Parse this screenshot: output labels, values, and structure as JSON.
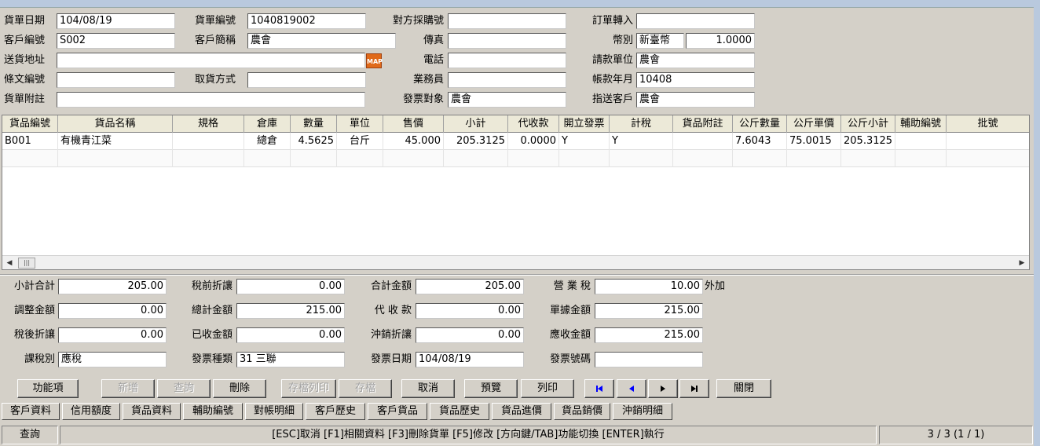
{
  "header": {
    "order_date_label": "貨單日期",
    "order_date": "104/08/19",
    "order_no_label": "貨單編號",
    "order_no": "1040819002",
    "po_no_label": "對方採購號",
    "po_no": "",
    "order_import_label": "訂單轉入",
    "order_import": "",
    "customer_id_label": "客戶編號",
    "customer_id": "S002",
    "customer_short_label": "客戶簡稱",
    "customer_short": "農會",
    "fax_label": "傳真",
    "fax": "",
    "currency_label": "幣別",
    "currency": "新臺幣",
    "exchange_rate": "1.0000",
    "ship_addr_label": "送貨地址",
    "ship_addr": "",
    "map_label": "MAP",
    "phone_label": "電話",
    "phone": "",
    "billing_unit_label": "請款單位",
    "billing_unit": "農會",
    "terms_no_label": "條文編號",
    "terms_no": "",
    "pickup_label": "取貨方式",
    "pickup": "",
    "sales_label": "業務員",
    "sales": "",
    "account_month_label": "帳款年月",
    "account_month": "10408",
    "note_label": "貨單附註",
    "note": "",
    "invoice_target_label": "發票對象",
    "invoice_target": "農會",
    "deliver_to_label": "指送客戶",
    "deliver_to": "農會"
  },
  "grid": {
    "columns": [
      "貨品編號",
      "貨品名稱",
      "規格",
      "倉庫",
      "數量",
      "單位",
      "售價",
      "小計",
      "代收款",
      "開立發票",
      "計稅",
      "貨品附註",
      "公斤數量",
      "公斤單價",
      "公斤小計",
      "輔助編號",
      "批號"
    ],
    "rows": [
      {
        "item_no": "B001",
        "item_name": "有機青江菜",
        "spec": "",
        "warehouse": "總倉",
        "qty": "4.5625",
        "unit": "台斤",
        "price": "45.000",
        "subtotal": "205.3125",
        "collect": "0.0000",
        "invoice": "Y",
        "tax": "Y",
        "item_note": "",
        "kg_qty": "7.6043",
        "kg_price": "75.0015",
        "kg_subtotal": "205.3125",
        "aux_no": "",
        "batch_no": ""
      }
    ]
  },
  "totals": {
    "subtotal_label": "小計合計",
    "subtotal": "205.00",
    "pretax_discount_label": "稅前折讓",
    "pretax_discount": "0.00",
    "total_amount_label": "合計金額",
    "total_amount": "205.00",
    "business_tax_label": "營 業 稅",
    "business_tax": "10.00",
    "tax_mode": "外加",
    "adjust_label": "調整金額",
    "adjust": "0.00",
    "grand_total_label": "總計金額",
    "grand_total": "215.00",
    "collect_label": "代 收 款",
    "collect": "0.00",
    "doc_amount_label": "單據金額",
    "doc_amount": "215.00",
    "posttax_discount_label": "稅後折讓",
    "posttax_discount": "0.00",
    "received_label": "已收金額",
    "received": "0.00",
    "offset_discount_label": "沖銷折讓",
    "offset_discount": "0.00",
    "receivable_label": "應收金額",
    "receivable": "215.00",
    "tax_type_label": "課稅別",
    "tax_type": "應稅",
    "invoice_kind_label": "發票種類",
    "invoice_kind": "31 三聯",
    "invoice_date_label": "發票日期",
    "invoice_date": "104/08/19",
    "invoice_no_label": "發票號碼",
    "invoice_no": ""
  },
  "toolbar": {
    "func": "功能項",
    "add": "新增",
    "query": "查詢",
    "delete": "刪除",
    "save_print": "存檔列印",
    "save": "存檔",
    "cancel": "取消",
    "preview": "預覽",
    "print": "列印",
    "close": "關閉"
  },
  "tabs": [
    "客戶資料",
    "信用額度",
    "貨品資料",
    "輔助編號",
    "對帳明細",
    "客戶歷史",
    "客戶貨品",
    "貨品歷史",
    "貨品進價",
    "貨品銷價",
    "沖銷明細"
  ],
  "status": {
    "mode": "查詢",
    "hint": "[ESC]取消 [F1]相關資料 [F3]刪除貨單 [F5]修改 [方向鍵/TAB]功能切換 [ENTER]執行",
    "record": "3 / 3 (1 / 1)"
  },
  "colors": {
    "nav_arrow": "#0000ff",
    "map_button": "#e06a1a",
    "window_bg": "#d4d0c8"
  }
}
